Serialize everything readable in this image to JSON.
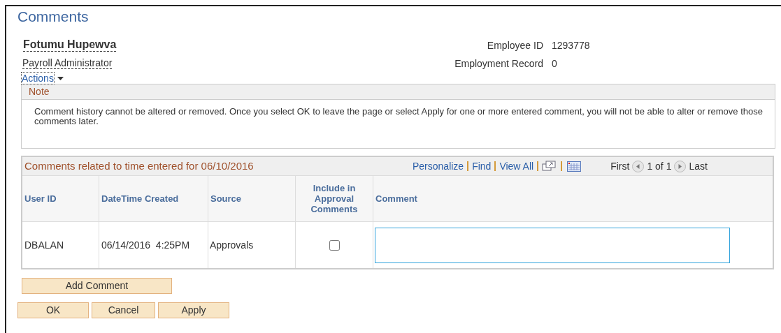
{
  "page_title": "Comments",
  "employee": {
    "name": "Fotumu Hupewva",
    "role": "Payroll Administrator",
    "actions": "Actions",
    "fields": [
      {
        "label": "Employee ID",
        "value": "1293778"
      },
      {
        "label": "Employment Record",
        "value": "0"
      }
    ]
  },
  "note": {
    "title": "Note",
    "text": "Comment history cannot be altered or removed. Once you select OK to leave the page or select Apply for one or more entered comment, you will not be able to alter or remove those comments later."
  },
  "grid": {
    "title": "Comments related to time entered for 06/10/2016",
    "links": [
      "Personalize",
      "Find",
      "View All"
    ],
    "first": "First",
    "count": "1 of 1",
    "last": "Last",
    "columns": [
      "User ID",
      "DateTime Created",
      "Source",
      "Include in Approval Comments",
      "Comment"
    ],
    "rows": [
      {
        "user_id": "DBALAN",
        "created": "06/14/2016  4:25PM",
        "source": "Approvals",
        "include_checked": false
      }
    ]
  },
  "add_button": "Add Comment",
  "buttons": [
    "OK",
    "Cancel",
    "Apply"
  ]
}
